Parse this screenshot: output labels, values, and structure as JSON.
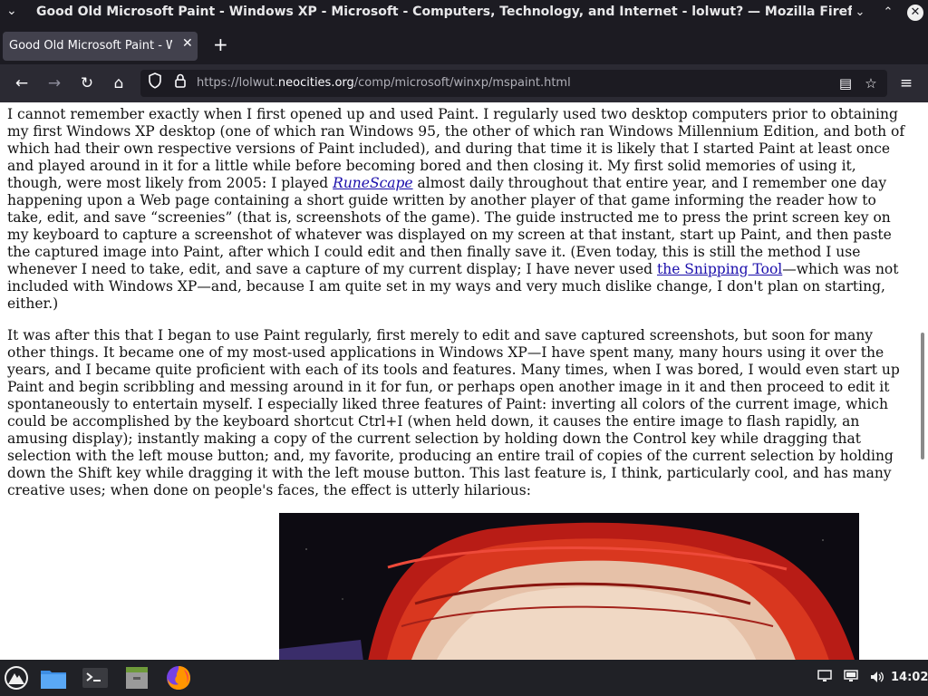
{
  "window": {
    "title": "Good Old Microsoft Paint - Windows XP - Microsoft - Computers, Technology, and Internet - lolwut? — Mozilla Firef...",
    "menu_icon": "chevron-down-icon",
    "min_glyph": "⌄",
    "max_glyph": "⌃",
    "close_glyph": "✕"
  },
  "tabs": [
    {
      "label": "Good Old Microsoft Paint - Windo",
      "close_glyph": "✕"
    }
  ],
  "newtab_glyph": "+",
  "nav": {
    "back_glyph": "←",
    "forward_glyph": "→",
    "reload_glyph": "↻",
    "home_glyph": "⌂",
    "url_prefix": "https://lolwut.",
    "url_host": "neocities.org",
    "url_path": "/comp/microsoft/winxp/mspaint.html",
    "reader_glyph": "▤",
    "bookmark_glyph": "☆",
    "menu_glyph": "≡"
  },
  "content": {
    "p1_before_link1": "I cannot remember exactly when I first opened up and used Paint. I regularly used two desktop computers prior to obtaining my first Windows XP desktop (one of which ran Windows 95, the other of which ran Windows Millennium Edition, and both of which had their own respective versions of Paint included), and during that time it is likely that I started Paint at least once and played around in it for a little while before becoming bored and then closing it. My first solid memories of using it, though, were most likely from 2005: I played ",
    "link1": "RuneScape",
    "p1_between_links": " almost daily throughout that entire year, and I remember one day happening upon a Web page containing a short guide written by another player of that game informing the reader how to take, edit, and save “screenies” (that is, screenshots of the game). The guide instructed me to press the print screen key on my keyboard to capture a screenshot of whatever was displayed on my screen at that instant, start up Paint, and then paste the captured image into Paint, after which I could edit and then finally save it. (Even today, this is still the method I use whenever I need to take, edit, and save a capture of my current display; I have never used ",
    "link2": "the Snipping Tool",
    "p1_after_link2": "—which was not included with Windows XP—and, because I am quite set in my ways and very much dislike change, I don't plan on starting, either.)",
    "p2": "It was after this that I began to use Paint regularly, first merely to edit and save captured screenshots, but soon for many other things. It became one of my most-used applications in Windows XP—I have spent many, many hours using it over the years, and I became quite proficient with each of its tools and features. Many times, when I was bored, I would even start up Paint and begin scribbling and messing around in it for fun, or perhaps open another image in it and then proceed to edit it spontaneously to entertain myself. I especially liked three features of Paint: inverting all colors of the current image, which could be accomplished by the keyboard shortcut Ctrl+I (when held down, it causes the entire image to flash rapidly, an amusing display); instantly making a copy of the current selection by holding down the Control key while dragging that selection with the left mouse button; and, my favorite, producing an entire trail of copies of the current selection by holding down the Shift key while dragging it with the left mouse button. This last feature is, I think, particularly cool, and has many creative uses; when done on people's faces, the effect is utterly hilarious:"
  },
  "taskbar": {
    "clock": "14:02",
    "apps": [
      "start-menu-icon",
      "file-manager-icon",
      "terminal-icon",
      "archive-icon",
      "firefox-icon"
    ],
    "tray": [
      "network-icon",
      "display-icon",
      "volume-icon"
    ]
  },
  "colors": {
    "link": "#1a0dab",
    "chrome_dark": "#1c1b22",
    "navbar": "#2b2a33",
    "tab_active": "#42414d",
    "photo_red": "#c8201a"
  }
}
